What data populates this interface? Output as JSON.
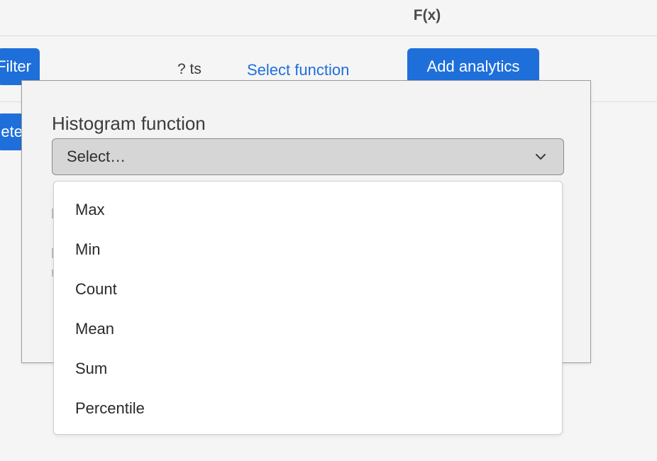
{
  "header": {
    "title": "F(x)"
  },
  "toolbar": {
    "filter_label": "Filter",
    "delete_label": "Delete",
    "ts_label": "? ts",
    "select_function_label": "Select function",
    "add_analytics_label": "Add analytics"
  },
  "modal": {
    "field_label": "Histogram function",
    "select": {
      "value": "Select…",
      "icon": "chevron-down-icon",
      "options": [
        "Max",
        "Min",
        "Count",
        "Mean",
        "Sum",
        "Percentile"
      ]
    }
  },
  "colors": {
    "accent": "#1f6fdb",
    "background": "#f5f5f5",
    "select_background": "#d6d6d6",
    "dropdown_background": "#ffffff"
  }
}
